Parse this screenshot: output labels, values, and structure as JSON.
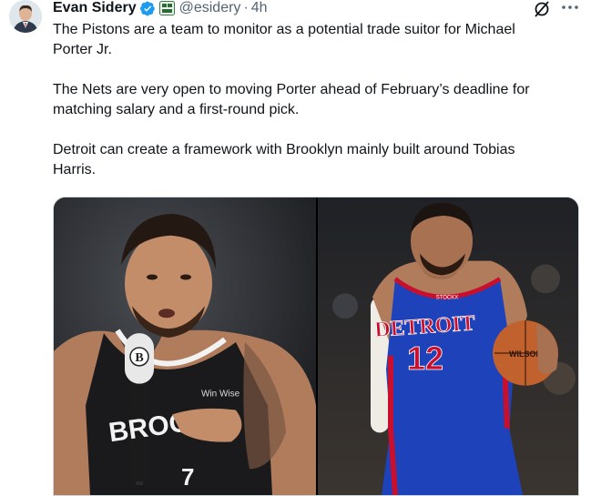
{
  "tweet": {
    "author_name": "Evan Sidery",
    "handle": "@esidery",
    "separator": "·",
    "time": "4h",
    "paragraphs": [
      "The Pistons are a team to monitor as a potential trade suitor for Michael\nPorter Jr.",
      "The Nets are very open to moving Porter ahead of February’s deadline for\nmatching salary and a first-round pick.",
      "Detroit can create a framework with Brooklyn mainly built around Tobias\nHarris."
    ]
  },
  "media": {
    "left_photo": {
      "microphone_letter": "B",
      "jersey_text": "BROO",
      "jersey_tag": "Win Wise",
      "jersey_number": "7"
    },
    "right_photo": {
      "jersey_text": "DETROIT",
      "jersey_number": "12",
      "sponsor": "STOCKX",
      "ball_text": "WILSON"
    }
  },
  "icons": [
    "avatar",
    "verified-icon",
    "affiliate-badge-icon",
    "grok-icon",
    "more-icon"
  ],
  "colors": {
    "verified": "#1d9bf0",
    "text": "#0f1419",
    "secondary": "#536471",
    "pistons_blue": "#1d42ba",
    "pistons_red": "#c8102e"
  }
}
